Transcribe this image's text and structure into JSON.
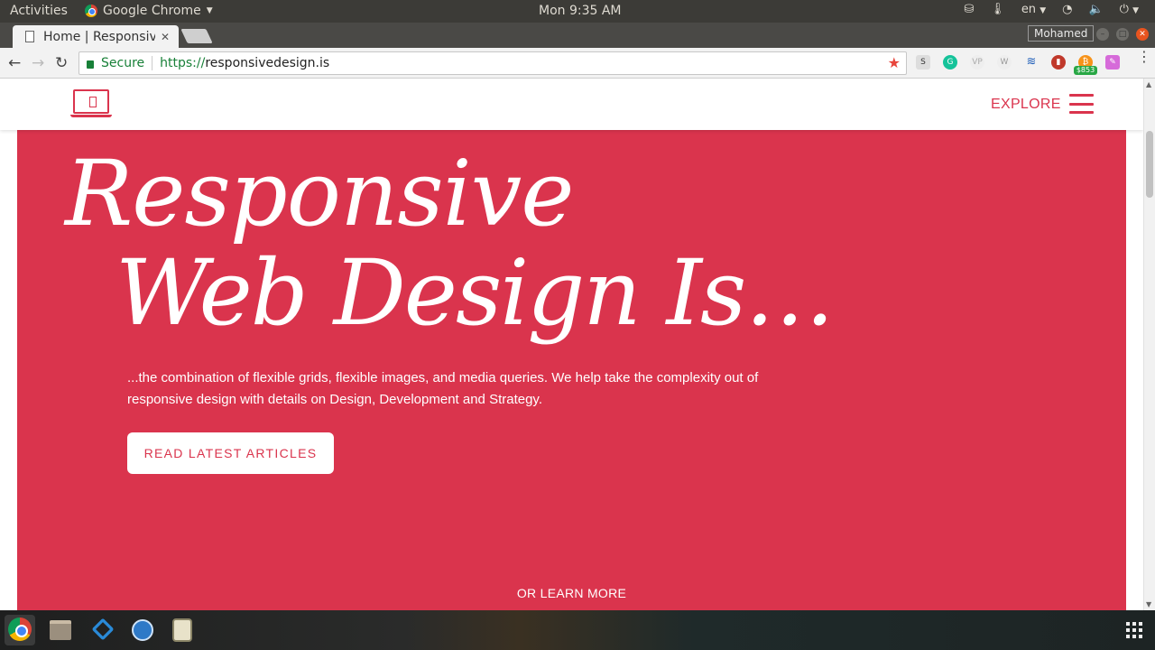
{
  "topbar": {
    "activities": "Activities",
    "app_name": "Google Chrome",
    "clock": "Mon  9:35 AM",
    "lang": "en"
  },
  "browser": {
    "tab_title": "Home | Responsive",
    "profile": "Mohamed",
    "secure_label": "Secure",
    "url_scheme": "https://",
    "url_host": "responsivedesign.is",
    "extension_badge": "$853"
  },
  "site": {
    "explore": "EXPLORE",
    "headline_line1": "Responsive",
    "headline_line2": "Web Design Is…",
    "lead": "...the combination of flexible grids, flexible images, and media queries. We help take the complexity out of responsive design with details on Design, Development and Strategy.",
    "cta": "READ LATEST ARTICLES",
    "learn_more": "OR LEARN MORE",
    "brand_color": "#da344d"
  }
}
